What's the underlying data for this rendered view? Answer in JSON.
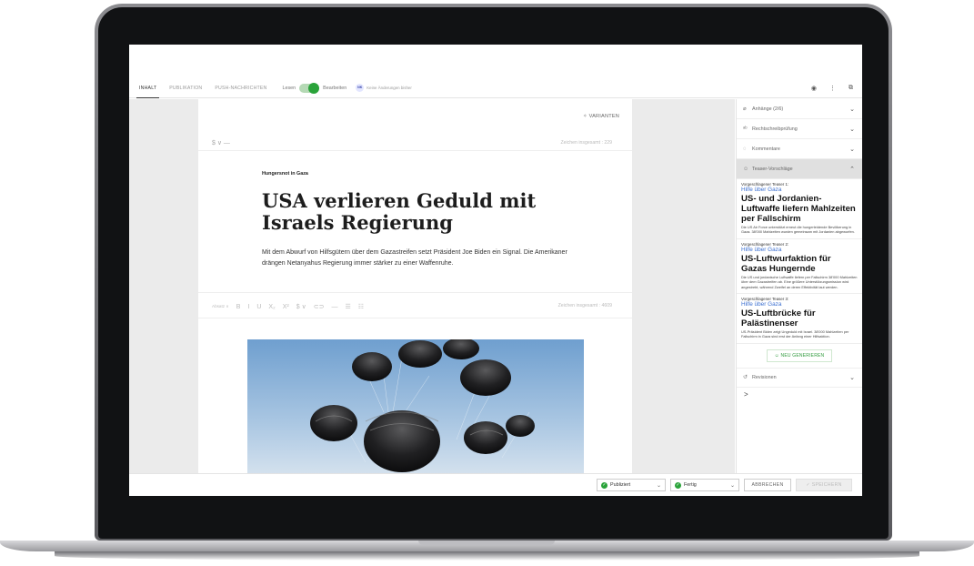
{
  "tabs": [
    {
      "label": "INHALT",
      "active": true
    },
    {
      "label": "PUBLIKATION",
      "active": false
    },
    {
      "label": "PUSH-NACHRICHTEN",
      "active": false
    }
  ],
  "mode": {
    "read_label": "Lesen",
    "edit_label": "Bearbeiten",
    "edit_on": true
  },
  "user_badge": "NK",
  "status_text": "Keine Änderungen bisher",
  "editor": {
    "variants_label": "VARIANTEN",
    "price_marker": "$ ∨   —",
    "count_top": "Zeichen insgesamt : 229",
    "kicker": "Hungersnot in Gaza",
    "headline": "USA verlieren Geduld mit Israels Regierung",
    "lead": "Mit dem Abwurf von Hilfsgütern über dem Gazastreifen setzt Präsident Joe Biden ein Signal. Die Amerikaner drängen Netanyahus Regierung immer stärker zu einer Waffenruhe.",
    "toolbar": [
      "Absatz ∨",
      "B",
      "I",
      "U",
      "X₂",
      "X²",
      "$ ∨",
      "⊂⊃",
      "—",
      "☰",
      "☷"
    ],
    "count_body": "Zeichen insgesamt : 4609"
  },
  "panel": {
    "sections": [
      {
        "label": "Anhänge (2/6)",
        "icon": "paperclip-icon",
        "glyph": "⌀"
      },
      {
        "label": "Rechtschreibprüfung",
        "icon": "spellcheck-icon",
        "glyph": "ᵃᵇ"
      },
      {
        "label": "Kommentare",
        "icon": "comment-icon",
        "glyph": "◌"
      }
    ],
    "teaser_section": {
      "label": "Teaser-Vorschläge",
      "icon": "robot-icon",
      "glyph": "☺"
    },
    "teasers": [
      {
        "label": "Vorgeschlagener Teaser 1:",
        "kicker": "Hilfe über Gaza",
        "headline": "US- und Jordanien-Luftwaffe liefern Mahlzeiten per Fallschirm",
        "text": "Die US Air Force unterstützt erneut die hungerleidende Bevölkerung in Gaza. 38'000 Mahlzeiten wurden gemeinsam mit Jordanien abgeworfen."
      },
      {
        "label": "Vorgeschlagener Teaser 2:",
        "kicker": "Hilfe über Gaza",
        "headline": "US-Luftwurfaktion für Gazas Hungernde",
        "text": "Die US und jordanische Luftwaffe liefern per Fallschirm 38'000 Mahlzeiten über dem Gazastreifen ab. Eine größere Unterstützungsmission wird angestrebt, während Zweifel an deren Effektivität laut werden."
      },
      {
        "label": "Vorgeschlagener Teaser 3:",
        "kicker": "Hilfe über Gaza",
        "headline": "US-Luftbrücke für Palästinenser",
        "text": "US-Präsident Biden zeigt Ungeduld mit Israel. 38'000 Mahlzeiten per Fallschirm in Gaza sind erst der Anfang einer Hilfsaktion."
      }
    ],
    "regen_label": "NEU GENERIEREN",
    "revisions_label": "Revisionen",
    "more_glyph": ">"
  },
  "bottom": {
    "status1": "Publiziert",
    "status2": "Fertig",
    "cancel": "ABBRECHEN",
    "save": "SPEICHERN"
  }
}
